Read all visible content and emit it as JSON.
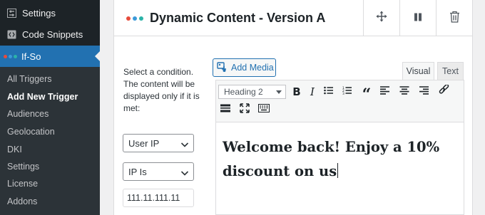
{
  "sidebar": {
    "settings_label": "Settings",
    "snippets_label": "Code Snippets",
    "plugin_label": "If-So",
    "submenu": [
      "All Triggers",
      "Add New Trigger",
      "Audiences",
      "Geolocation",
      "DKI",
      "Settings",
      "License",
      "Addons"
    ]
  },
  "panel": {
    "title": "Dynamic Content - Version A",
    "condition_text": "Select a condition. The content will be displayed only if it is met:",
    "condition_select": "User IP",
    "operator_select": "IP Is",
    "ip_value": "111.11.111.11"
  },
  "editor": {
    "add_media_label": "Add Media",
    "tab_visual": "Visual",
    "tab_text": "Text",
    "format_select": "Heading 2",
    "content": "Welcome back! Enjoy a 10% discount on us"
  },
  "colors": {
    "sidebar_bg": "#1d2327",
    "accent": "#2271b1",
    "dot_red": "#e74c3c",
    "dot_blue": "#3b9ad9",
    "dot_teal": "#2bb3a8"
  },
  "icons": [
    "settings-icon",
    "code-icon",
    "ifso-logo",
    "move-icon",
    "pause-icon",
    "trash-icon",
    "add-media-icon",
    "bold-icon",
    "italic-icon",
    "bullet-list-icon",
    "numbered-list-icon",
    "blockquote-icon",
    "align-left-icon",
    "align-center-icon",
    "align-right-icon",
    "link-icon",
    "horizontal-line-icon",
    "fullscreen-icon",
    "keyboard-icon"
  ]
}
